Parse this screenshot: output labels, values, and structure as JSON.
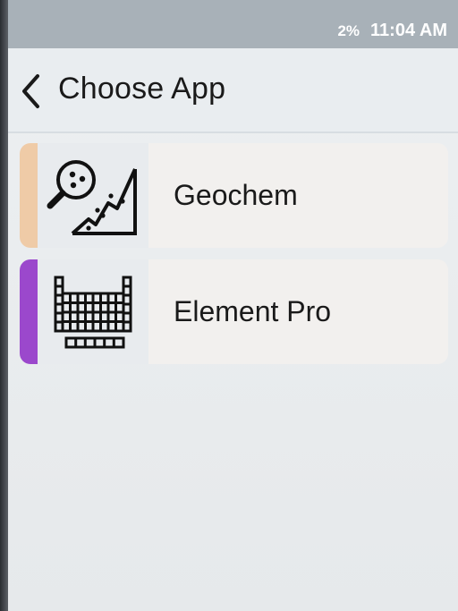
{
  "status": {
    "battery": "2%",
    "time": "11:04 AM"
  },
  "header": {
    "title": "Choose App",
    "back_icon": "chevron-left-icon"
  },
  "apps": [
    {
      "label": "Geochem",
      "icon": "magnifier-chart-icon",
      "accent_color": "#efcba7"
    },
    {
      "label": "Element Pro",
      "icon": "periodic-table-icon",
      "accent_color": "#9b48cc"
    }
  ]
}
